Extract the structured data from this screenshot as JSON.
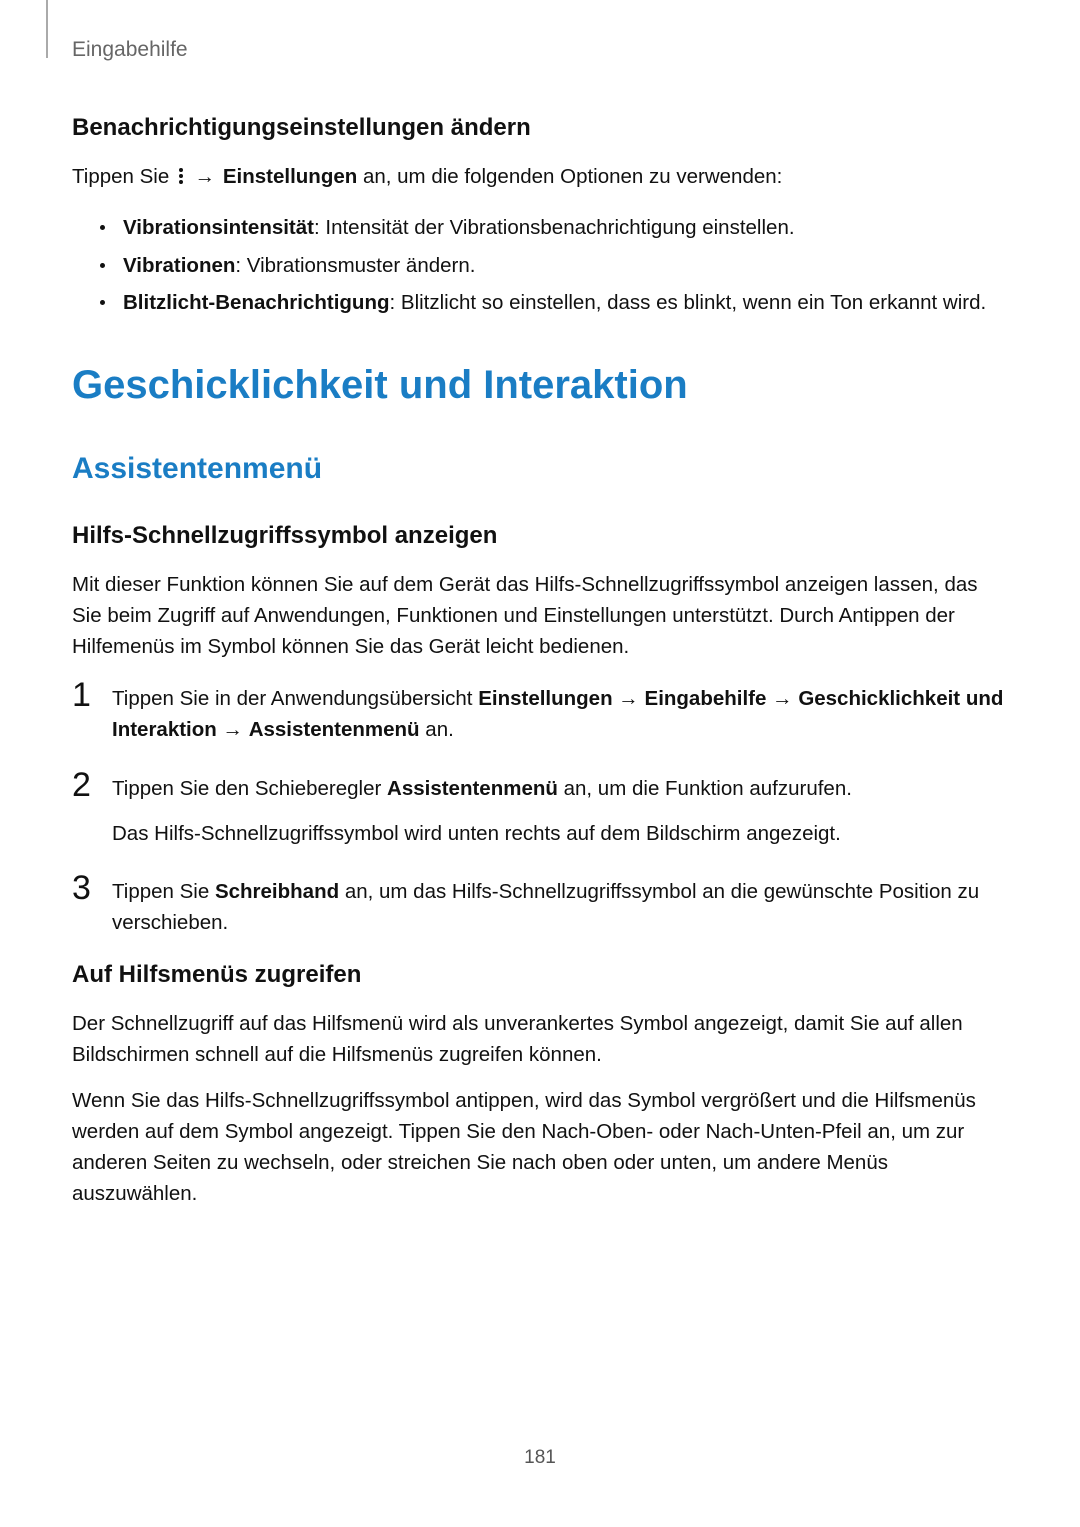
{
  "breadcrumb": "Eingabehilfe",
  "section1": {
    "title": "Benachrichtigungseinstellungen ändern",
    "intro_pre": "Tippen Sie ",
    "intro_arrow": " → ",
    "intro_bold": "Einstellungen",
    "intro_post": " an, um die folgenden Optionen zu verwenden:",
    "bullets": [
      {
        "bold": "Vibrationsintensität",
        "text": ": Intensität der Vibrationsbenachrichtigung einstellen."
      },
      {
        "bold": "Vibrationen",
        "text": ": Vibrationsmuster ändern."
      },
      {
        "bold": "Blitzlicht-Benachrichtigung",
        "text": ": Blitzlicht so einstellen, dass es blinkt, wenn ein Ton erkannt wird."
      }
    ]
  },
  "h1": "Geschicklichkeit und Interaktion",
  "h2": "Assistentenmenü",
  "section2": {
    "title": "Hilfs-Schnellzugriffssymbol anzeigen",
    "intro": "Mit dieser Funktion können Sie auf dem Gerät das Hilfs-Schnellzugriffssymbol anzeigen lassen, das Sie beim Zugriff auf Anwendungen, Funktionen und Einstellungen unterstützt. Durch Antippen der Hilfemenüs im Symbol können Sie das Gerät leicht bedienen.",
    "steps": [
      {
        "num": "1",
        "pre": "Tippen Sie in der Anwendungsübersicht ",
        "b1": "Einstellungen",
        "a1": " → ",
        "b2": "Eingabehilfe",
        "a2": " → ",
        "b3": "Geschicklichkeit und Interaktion",
        "a3": " → ",
        "b4": "Assistentenmenü",
        "post": " an."
      },
      {
        "num": "2",
        "pre": "Tippen Sie den Schieberegler ",
        "b1": "Assistentenmenü",
        "post": " an, um die Funktion aufzurufen.",
        "sub": "Das Hilfs-Schnellzugriffssymbol wird unten rechts auf dem Bildschirm angezeigt."
      },
      {
        "num": "3",
        "pre": "Tippen Sie ",
        "b1": "Schreibhand",
        "post": " an, um das Hilfs-Schnellzugriffssymbol an die gewünschte Position zu verschieben."
      }
    ]
  },
  "section3": {
    "title": "Auf Hilfsmenüs zugreifen",
    "p1": "Der Schnellzugriff auf das Hilfsmenü wird als unverankertes Symbol angezeigt, damit Sie auf allen Bildschirmen schnell auf die Hilfsmenüs zugreifen können.",
    "p2": "Wenn Sie das Hilfs-Schnellzugriffssymbol antippen, wird das Symbol vergrößert und die Hilfsmenüs werden auf dem Symbol angezeigt. Tippen Sie den Nach-Oben- oder Nach-Unten-Pfeil an, um zur anderen Seiten zu wechseln, oder streichen Sie nach oben oder unten, um andere Menüs auszuwählen."
  },
  "page_number": "181"
}
